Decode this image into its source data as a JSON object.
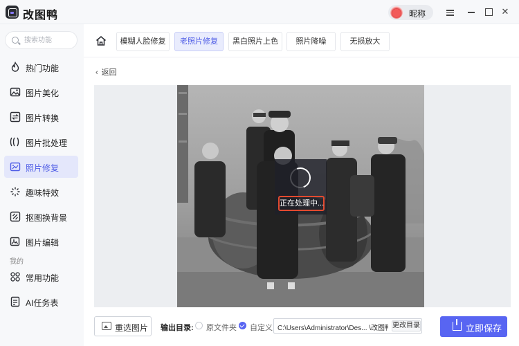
{
  "app": {
    "title": "改图鸭",
    "user_nickname": "昵称"
  },
  "window_controls": {
    "close_glyph": "✕"
  },
  "search": {
    "placeholder": "搜索功能"
  },
  "sidebar": {
    "items": [
      {
        "label": "热门功能",
        "icon": "flame-icon"
      },
      {
        "label": "图片美化",
        "icon": "image-icon"
      },
      {
        "label": "图片转换",
        "icon": "convert-icon"
      },
      {
        "label": "图片批处理",
        "icon": "batch-icon"
      },
      {
        "label": "照片修复",
        "icon": "photo-repair-icon",
        "active": true
      },
      {
        "label": "趣味特效",
        "icon": "sparkle-icon"
      },
      {
        "label": "抠图换背景",
        "icon": "cutout-icon"
      },
      {
        "label": "图片编辑",
        "icon": "edit-image-icon"
      }
    ],
    "section_label": "我的",
    "my_items": [
      {
        "label": "常用功能",
        "icon": "grid-icon"
      },
      {
        "label": "AI任务表",
        "icon": "document-icon"
      }
    ]
  },
  "tabs": [
    {
      "label": "模糊人脸修复"
    },
    {
      "label": "老照片修复",
      "active": true
    },
    {
      "label": "黑白照片上色"
    },
    {
      "label": "照片降噪"
    },
    {
      "label": "无损放大"
    }
  ],
  "back_label": "返回",
  "processing": {
    "text": "正在处理中..."
  },
  "bottom": {
    "reselect_label": "重选图片",
    "output_dir_label": "输出目录:",
    "option_original": "原文件夹",
    "option_custom": "自定义",
    "selected_option": "自定义",
    "path_value": "C:\\Users\\Administrator\\Des... \\改图鸭",
    "change_dir_label": "更改目录",
    "save_label": "立即保存"
  },
  "colors": {
    "accent": "#5865f2",
    "highlight_border": "#e34a2f"
  }
}
